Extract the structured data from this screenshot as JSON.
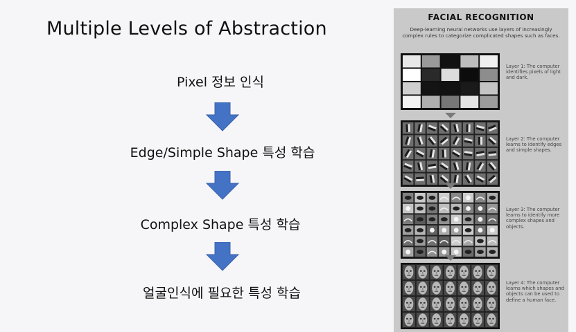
{
  "slide": {
    "title": "Multiple Levels of Abstraction",
    "steps": [
      {
        "label": "Pixel 정보 인식"
      },
      {
        "label": "Edge/Simple Shape 특성 학습"
      },
      {
        "label": "Complex Shape 특성 학습"
      },
      {
        "label": "얼굴인식에 필요한 특성 학습"
      }
    ],
    "arrow_color": "#4472c4"
  },
  "infographic": {
    "title": "FACIAL RECOGNITION",
    "subtitle": "Deep-learning neural networks use layers of increasingly complex rules to categorize complicated shapes such as faces.",
    "layers": [
      {
        "caption": "Layer 1: The computer identifies pixels of light and dark."
      },
      {
        "caption": "Layer 2: The computer learns to identify edges and simple shapes."
      },
      {
        "caption": "Layer 3: The computer learns to identify more complex shapes and objects."
      },
      {
        "caption": "Layer 4: The computer learns which shapes and objects can be used to define a human face."
      }
    ]
  }
}
